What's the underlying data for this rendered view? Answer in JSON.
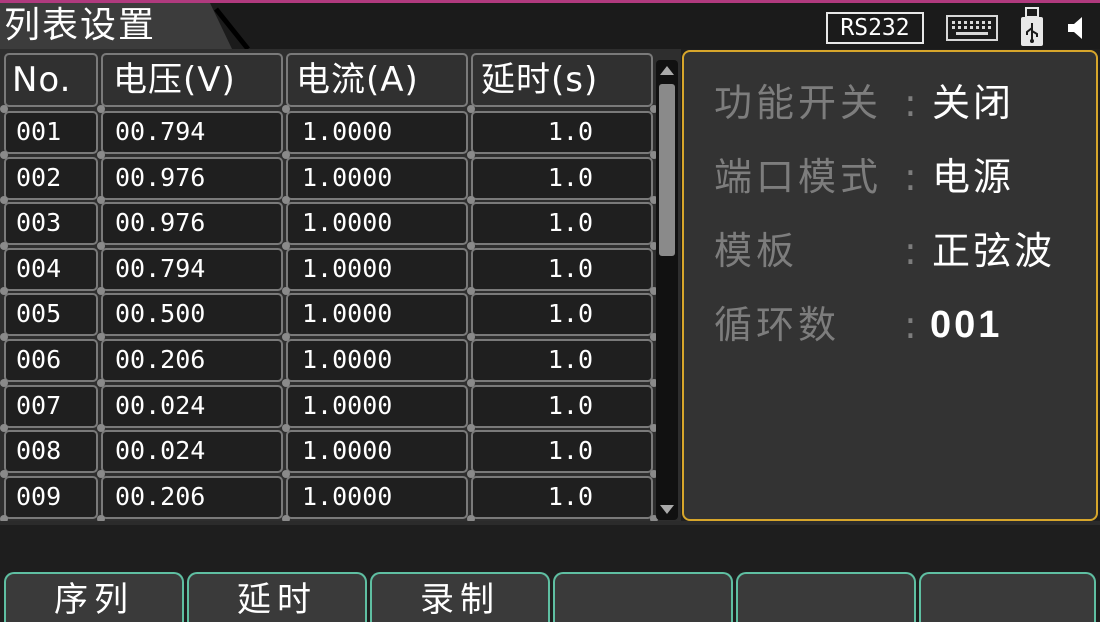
{
  "title": "列表设置",
  "status": {
    "interface": "RS232",
    "icons": [
      "keyboard-icon",
      "usb-icon",
      "speaker-icon"
    ]
  },
  "table": {
    "headers": [
      "No.",
      "电压(V)",
      "电流(A)",
      "延时(s)"
    ],
    "rows": [
      [
        "001",
        "00.794",
        "1.0000",
        "1.0"
      ],
      [
        "002",
        "00.976",
        "1.0000",
        "1.0"
      ],
      [
        "003",
        "00.976",
        "1.0000",
        "1.0"
      ],
      [
        "004",
        "00.794",
        "1.0000",
        "1.0"
      ],
      [
        "005",
        "00.500",
        "1.0000",
        "1.0"
      ],
      [
        "006",
        "00.206",
        "1.0000",
        "1.0"
      ],
      [
        "007",
        "00.024",
        "1.0000",
        "1.0"
      ],
      [
        "008",
        "00.024",
        "1.0000",
        "1.0"
      ],
      [
        "009",
        "00.206",
        "1.0000",
        "1.0"
      ]
    ]
  },
  "info": {
    "function_switch": {
      "label": "功能开关",
      "colon": ":",
      "value": "关闭"
    },
    "port_mode": {
      "label": "端口模式",
      "colon": ":",
      "value": "电源"
    },
    "template": {
      "label": "模板",
      "colon": ":",
      "value": "正弦波"
    },
    "cycles": {
      "label": "循环数",
      "colon": ":",
      "value": "001"
    }
  },
  "softkeys": [
    "序列",
    "延时",
    "录制",
    "",
    "",
    ""
  ],
  "colors": {
    "accent_top": "#b03a7e",
    "panel_border": "#d7a62b",
    "softkey_border": "#5fbfa2"
  }
}
